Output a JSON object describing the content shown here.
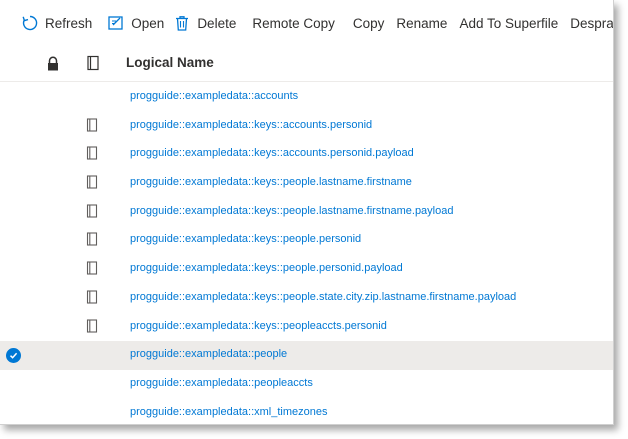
{
  "toolbar": {
    "refresh_label": "Refresh",
    "open_label": "Open",
    "delete_label": "Delete",
    "remote_copy_label": "Remote Copy",
    "copy_label": "Copy",
    "rename_label": "Rename",
    "add_to_superfile_label": "Add To Superfile",
    "despray_label": "Despray"
  },
  "table": {
    "column_header": "Logical Name",
    "rows": [
      {
        "name": "progguide::exampledata::accounts",
        "has_index_icon": false,
        "selected": false
      },
      {
        "name": "progguide::exampledata::keys::accounts.personid",
        "has_index_icon": true,
        "selected": false
      },
      {
        "name": "progguide::exampledata::keys::accounts.personid.payload",
        "has_index_icon": true,
        "selected": false
      },
      {
        "name": "progguide::exampledata::keys::people.lastname.firstname",
        "has_index_icon": true,
        "selected": false
      },
      {
        "name": "progguide::exampledata::keys::people.lastname.firstname.payload",
        "has_index_icon": true,
        "selected": false
      },
      {
        "name": "progguide::exampledata::keys::people.personid",
        "has_index_icon": true,
        "selected": false
      },
      {
        "name": "progguide::exampledata::keys::people.personid.payload",
        "has_index_icon": true,
        "selected": false
      },
      {
        "name": "progguide::exampledata::keys::people.state.city.zip.lastname.firstname.payload",
        "has_index_icon": true,
        "selected": false
      },
      {
        "name": "progguide::exampledata::keys::peopleaccts.personid",
        "has_index_icon": true,
        "selected": false
      },
      {
        "name": "progguide::exampledata::people",
        "has_index_icon": false,
        "selected": true
      },
      {
        "name": "progguide::exampledata::peopleaccts",
        "has_index_icon": false,
        "selected": false
      },
      {
        "name": "progguide::exampledata::xml_timezones",
        "has_index_icon": false,
        "selected": false
      }
    ]
  },
  "colors": {
    "accent": "#0078d4",
    "selected_row": "#edebe9"
  }
}
